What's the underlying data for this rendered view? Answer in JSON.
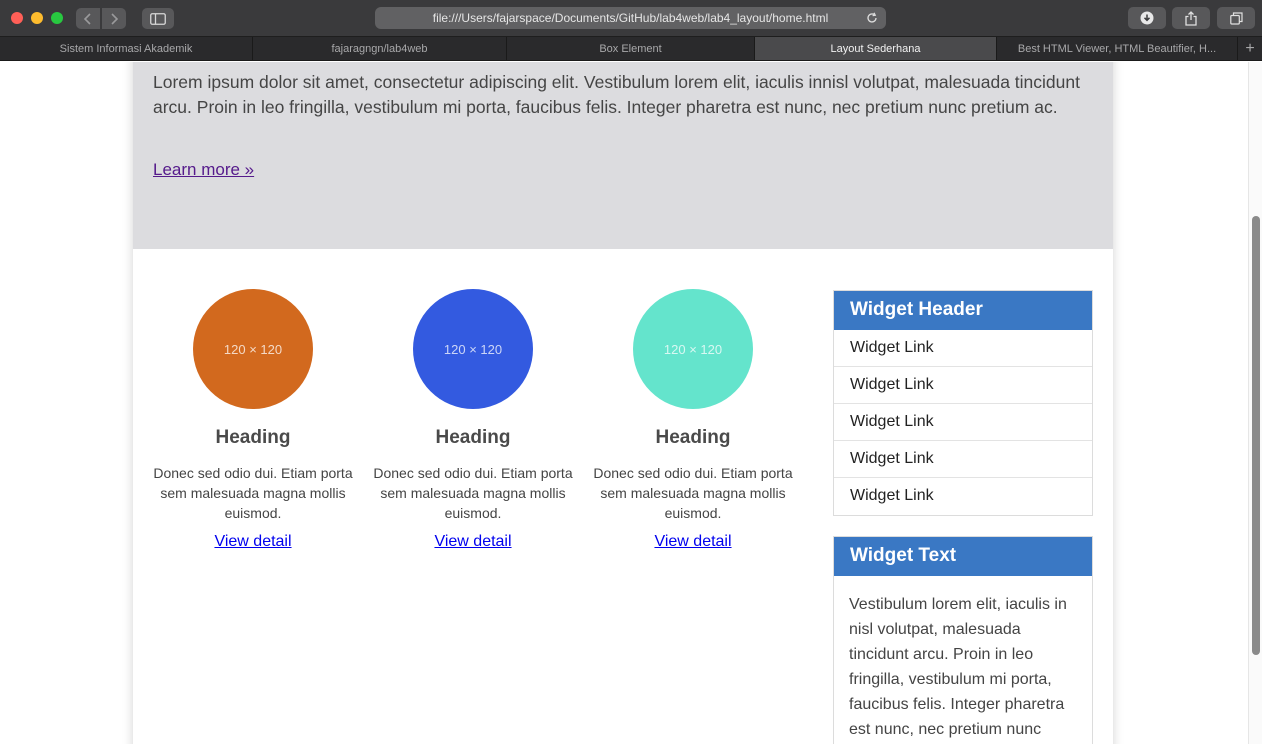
{
  "browser": {
    "url": "file:///Users/fajarspace/Documents/GitHub/lab4web/lab4_layout/home.html",
    "tabs": [
      {
        "label": "Sistem Informasi Akademik"
      },
      {
        "label": "fajaragngn/lab4web"
      },
      {
        "label": "Box Element"
      },
      {
        "label": "Layout Sederhana"
      },
      {
        "label": "Best HTML Viewer, HTML Beautifier, H..."
      }
    ],
    "active_tab": "Layout Sederhana",
    "icons": {
      "back": "chevron-left-icon",
      "forward": "chevron-right-icon",
      "sidebar": "sidebar-icon",
      "reload": "reload-icon",
      "download": "download-icon",
      "share": "share-icon",
      "tab_overview": "tabs-icon",
      "new_tab": "plus-icon"
    }
  },
  "hero": {
    "text": "Lorem ipsum dolor sit amet, consectetur adipiscing elit. Vestibulum lorem elit, iaculis innisl volutpat, malesuada tincidunt arcu. Proin in leo fringilla, vestibulum mi porta, faucibus felis. Integer pharetra est nunc, nec pretium nunc pretium ac.",
    "link": "Learn more »",
    "background": "#dcdcdf"
  },
  "features": [
    {
      "image_label": "120 × 120",
      "color": "#d2691e",
      "heading": "Heading",
      "text": "Donec sed odio dui. Etiam porta sem malesuada magna mollis euismod.",
      "link": "View detail"
    },
    {
      "image_label": "120 × 120",
      "color": "#335ae0",
      "heading": "Heading",
      "text": "Donec sed odio dui. Etiam porta sem malesuada magna mollis euismod.",
      "link": "View detail"
    },
    {
      "image_label": "120 × 120",
      "color": "#64e4cc",
      "heading": "Heading",
      "text": "Donec sed odio dui. Etiam porta sem malesuada magna mollis euismod.",
      "link": "View detail"
    }
  ],
  "widgets": {
    "links": {
      "header": "Widget Header",
      "items": [
        "Widget Link",
        "Widget Link",
        "Widget Link",
        "Widget Link",
        "Widget Link"
      ]
    },
    "text": {
      "header": "Widget Text",
      "body": "Vestibulum lorem elit, iaculis in nisl volutpat, malesuada tincidunt arcu. Proin in leo fringilla, vestibulum mi porta, faucibus felis. Integer pharetra est nunc, nec pretium nunc"
    },
    "accent": "#3a78c4"
  }
}
